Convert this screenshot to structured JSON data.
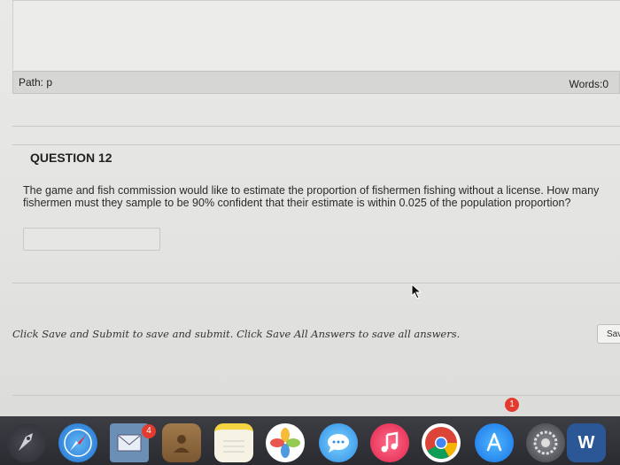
{
  "statusbar": {
    "path": "Path: p",
    "words": "Words:0"
  },
  "question": {
    "title": "QUESTION 12",
    "text": "The game and fish commission would like to estimate the proportion of fishermen fishing without a license. How many fishermen must they sample to be 90% confident that their estimate is within 0.025 of the population proportion?",
    "answer_value": ""
  },
  "footer": {
    "instructions": "Click Save and Submit to save and submit. Click Save All Answers to save all answers.",
    "save_label": "Sav"
  },
  "dock": {
    "items": [
      {
        "icon": "launchpad-icon"
      },
      {
        "icon": "safari-icon"
      },
      {
        "icon": "mail-icon",
        "badge": "4"
      },
      {
        "icon": "contacts-icon"
      },
      {
        "icon": "notes-icon"
      },
      {
        "icon": "photos-icon"
      },
      {
        "icon": "messages-icon"
      },
      {
        "icon": "music-icon"
      },
      {
        "icon": "chrome-icon"
      },
      {
        "icon": "app-store-icon",
        "badge": "1"
      },
      {
        "icon": "system-preferences-icon"
      },
      {
        "icon": "word-icon",
        "label": "W"
      }
    ]
  }
}
